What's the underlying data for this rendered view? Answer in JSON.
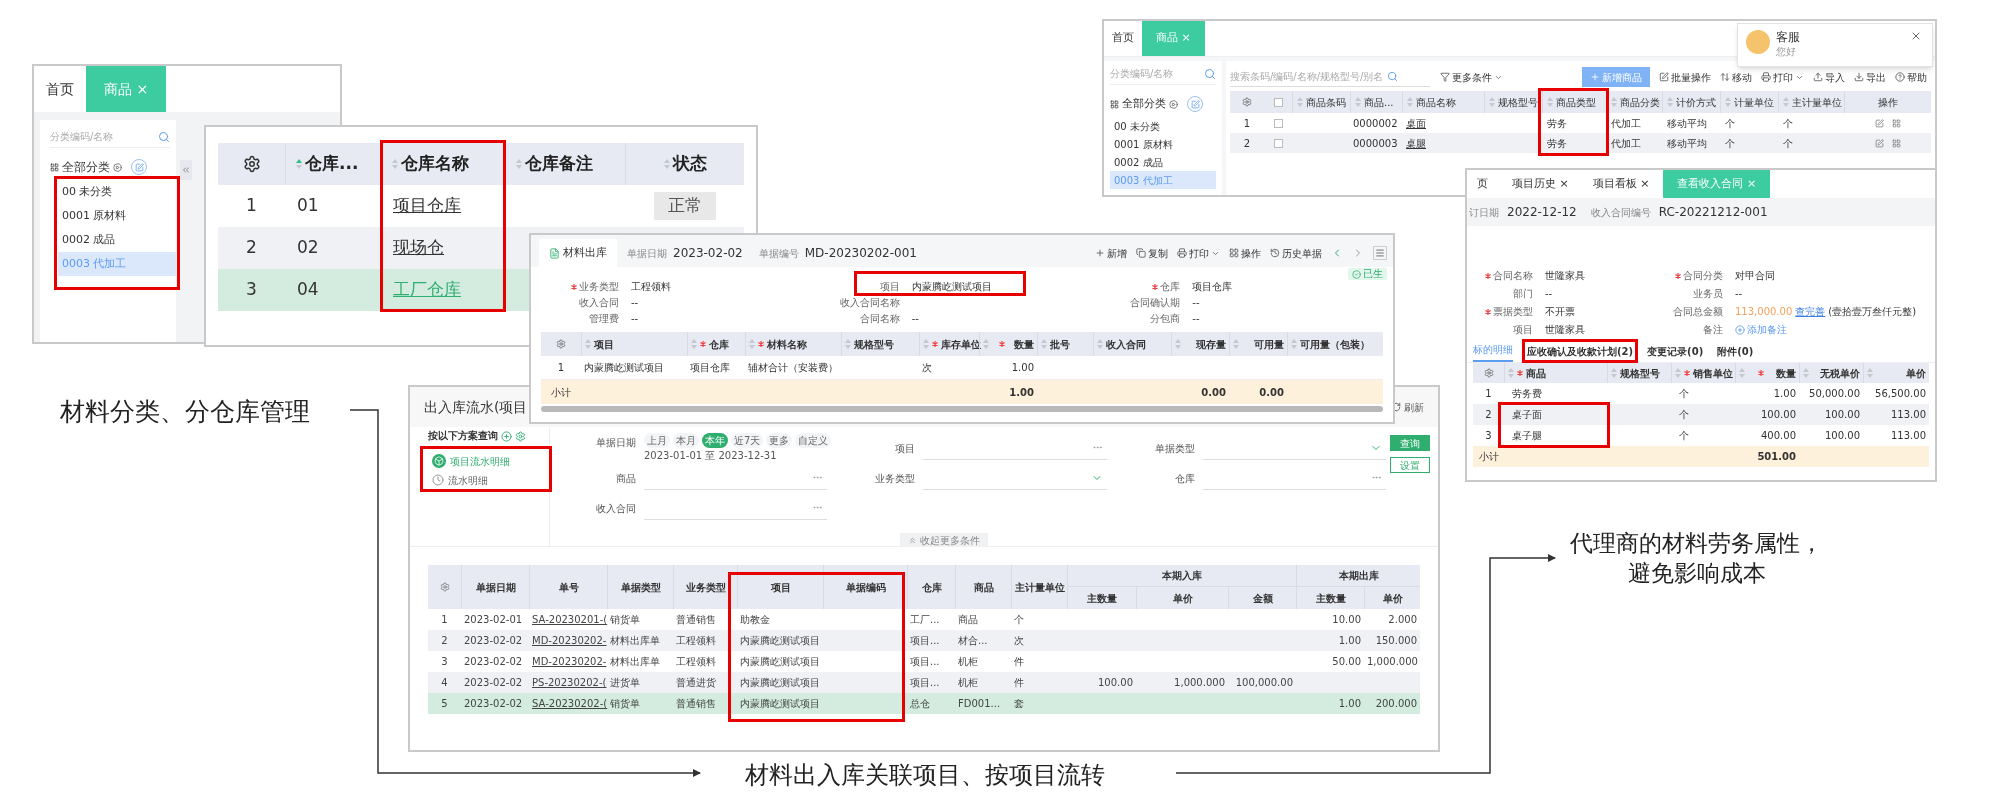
{
  "annotations": {
    "left": "材料分类、分仓库管理",
    "bottom": "材料出入库关联项目、按项目流转",
    "right": [
      "代理商的材料劳务属性，",
      "避免影响成本"
    ]
  },
  "category_panel": {
    "tabs": [
      {
        "label": "首页",
        "selected": false
      },
      {
        "label": "商品 ×",
        "selected": true
      }
    ],
    "search_placeholder": "分类编码/名称",
    "tree_root": "全部分类",
    "categories": [
      {
        "label": "00 未分类",
        "selected": false
      },
      {
        "label": "0001 原材料",
        "selected": false
      },
      {
        "label": "0002 成品",
        "selected": false
      },
      {
        "label": "0003 代加工",
        "selected": true
      }
    ]
  },
  "warehouse_table": {
    "columns": [
      {
        "label": "仓库...",
        "sorted": true
      },
      {
        "label": "仓库名称",
        "sorted": false
      },
      {
        "label": "仓库备注",
        "sorted": false
      },
      {
        "label": "状态",
        "sorted": false
      }
    ],
    "rows": [
      {
        "index": "1",
        "code": "01",
        "name": "项目仓库",
        "status": "正常",
        "selected": false
      },
      {
        "index": "2",
        "code": "02",
        "name": "现场仓",
        "selected": false
      },
      {
        "index": "3",
        "code": "04",
        "name": "工厂仓库",
        "selected": true
      }
    ]
  },
  "material_out": {
    "tab": "材料出库",
    "date_label": "单据日期",
    "date": "2023-02-02",
    "number_label": "单据编号",
    "number": "MD-20230202-001",
    "toolbar": [
      {
        "label": "新增",
        "kind": "add"
      },
      {
        "label": "复制",
        "kind": "copy"
      },
      {
        "label": "打印",
        "kind": "print"
      },
      {
        "label": "操作",
        "kind": "ops"
      },
      {
        "label": "历史单据",
        "kind": "history"
      }
    ],
    "status": "已生",
    "fields": [
      [
        {
          "label": "业务类型",
          "value": "工程领料",
          "required": true
        },
        {
          "label": "收入合同",
          "value": "--",
          "required": false
        },
        {
          "label": "管理费",
          "value": "--",
          "required": false
        }
      ],
      [
        {
          "label": "项目",
          "value": "内蒙腾屹测试项目",
          "required": false
        },
        {
          "label": "收入合同名称",
          "required": false
        },
        {
          "label": "合同名称",
          "value": "--",
          "required": false
        }
      ],
      [
        {
          "label": "仓库",
          "value": "项目仓库",
          "required": true
        },
        {
          "label": "合同确认期",
          "value": "--",
          "required": false
        },
        {
          "label": "分包商",
          "value": "--",
          "required": false
        }
      ]
    ],
    "columns": [
      {
        "label": "项目",
        "required": false
      },
      {
        "label": "仓库",
        "required": true
      },
      {
        "label": "材料名称",
        "required": true
      },
      {
        "label": "规格型号",
        "required": false
      },
      {
        "label": "库存单位",
        "required": true
      },
      {
        "label": "数量",
        "required": true,
        "numeric": true
      },
      {
        "label": "批号",
        "required": false
      },
      {
        "label": "收入合同",
        "required": false
      },
      {
        "label": "现存量",
        "required": false,
        "numeric": true
      },
      {
        "label": "可用量",
        "required": false,
        "numeric": true
      },
      {
        "label": "可用量（包装）",
        "required": false
      }
    ],
    "rows": [
      {
        "index": "1",
        "cells": [
          "内蒙腾屹测试项目",
          "项目仓库",
          "辅材合计（安装费）",
          null,
          "次",
          "1.00",
          null,
          null,
          null,
          null,
          null
        ]
      }
    ],
    "subtotal": {
      "label": "小计",
      "cells": [
        null,
        null,
        null,
        null,
        null,
        "1.00",
        null,
        null,
        "0.00",
        "0.00",
        null
      ]
    }
  },
  "flow": {
    "title": "出入库流水(项目",
    "refresh": "刷新",
    "scheme_header": "按以下方案查询",
    "schemes": [
      {
        "label": "项目流水明细",
        "selected": true
      },
      {
        "label": "流水明细",
        "selected": false
      }
    ],
    "date_label": "单据日期",
    "chips": [
      {
        "label": "上月",
        "selected": false
      },
      {
        "label": "本月",
        "selected": false
      },
      {
        "label": "本年",
        "selected": true
      },
      {
        "label": "近7天",
        "selected": false
      },
      {
        "label": "更多",
        "selected": false
      },
      {
        "label": "自定义",
        "selected": false
      }
    ],
    "date_range": "2023-01-01 至 2023-12-31",
    "filters": [
      {
        "label": "项目",
        "kind": "lookup"
      },
      {
        "label": "单据类型",
        "kind": "select"
      },
      {
        "label": "商品",
        "kind": "lookup"
      },
      {
        "label": "业务类型",
        "kind": "select"
      },
      {
        "label": "仓库",
        "kind": "lookup"
      },
      {
        "label": "收入合同",
        "kind": "lookup"
      }
    ],
    "query": "查询",
    "settings": "设置",
    "collapse": "收起更多条件",
    "columns": [
      {
        "label": "单据日期"
      },
      {
        "label": "单号",
        "link": true
      },
      {
        "label": "单据类型"
      },
      {
        "label": "业务类型"
      },
      {
        "label": "项目"
      },
      {
        "label": "单据编码"
      },
      {
        "label": "仓库"
      },
      {
        "label": "商品"
      },
      {
        "label": "主计量单位"
      }
    ],
    "groups": [
      {
        "label": "本期入库",
        "columns": [
          {
            "label": "主数量",
            "numeric": true
          },
          {
            "label": "单价",
            "numeric": true
          },
          {
            "label": "金额",
            "numeric": true
          }
        ]
      },
      {
        "label": "本期出库",
        "columns": [
          {
            "label": "主数量",
            "numeric": true
          },
          {
            "label": "单价",
            "numeric": true
          }
        ]
      }
    ],
    "rows": [
      {
        "index": "1",
        "selected": false,
        "cells": [
          "2023-02-01",
          "SA-20230201-(",
          "销货单",
          "普通销售",
          "助教金",
          null,
          "工厂...",
          "商品",
          "个",
          null,
          null,
          null,
          "10.00",
          "2.000"
        ]
      },
      {
        "index": "2",
        "selected": false,
        "cells": [
          "2023-02-02",
          "MD-20230202-",
          "材料出库单",
          "工程领料",
          "内蒙腾屹测试项目",
          null,
          "项目...",
          "材合...",
          "次",
          null,
          null,
          null,
          "1.00",
          "150.000"
        ]
      },
      {
        "index": "3",
        "selected": false,
        "cells": [
          "2023-02-02",
          "MD-20230202-",
          "材料出库单",
          "工程领料",
          "内蒙腾屹测试项目",
          null,
          "项目...",
          "机柜",
          "件",
          null,
          null,
          null,
          "50.00",
          "1,000.000"
        ]
      },
      {
        "index": "4",
        "selected": false,
        "cells": [
          "2023-02-02",
          "PS-20230202-(",
          "进货单",
          "普通进货",
          "内蒙腾屹测试项目",
          null,
          "项目...",
          "机柜",
          "件",
          "100.00",
          "1,000.000",
          "100,000.00",
          null,
          null
        ]
      },
      {
        "index": "5",
        "selected": true,
        "cells": [
          "2023-02-02",
          "SA-20230202-(",
          "销货单",
          "普通销售",
          "内蒙腾屹测试项目",
          null,
          "总仓",
          "FD001...",
          "套",
          null,
          null,
          null,
          "1.00",
          "200.000"
        ]
      }
    ]
  },
  "goods": {
    "tabs": [
      {
        "label": "首页",
        "selected": false
      },
      {
        "label": "商品 ×",
        "selected": true
      }
    ],
    "search_placeholder": "分类编码/名称",
    "tree_root": "全部分类",
    "categories": [
      {
        "label": "00 未分类",
        "selected": false
      },
      {
        "label": "0001 原材料",
        "selected": false
      },
      {
        "label": "0002 成品",
        "selected": false
      },
      {
        "label": "0003 代加工",
        "selected": true
      }
    ],
    "all_checked": false,
    "list_search_placeholder": "搜索条码/编码/名称/规格型号/别名",
    "more_filters": "更多条件",
    "add": "新增商品",
    "toolbar": [
      {
        "label": "批量操作",
        "kind": "batch"
      },
      {
        "label": "移动",
        "kind": "move"
      },
      {
        "label": "打印",
        "kind": "print"
      },
      {
        "label": "导入",
        "kind": "import"
      },
      {
        "label": "导出",
        "kind": "export"
      },
      {
        "label": "帮助",
        "kind": "help"
      }
    ],
    "columns": [
      {
        "label": "商品条码"
      },
      {
        "label": "商品..."
      },
      {
        "label": "商品名称",
        "link": true
      },
      {
        "label": "规格型号"
      },
      {
        "label": "商品类型"
      },
      {
        "label": "商品分类"
      },
      {
        "label": "计价方式"
      },
      {
        "label": "计量单位"
      },
      {
        "label": "主计量单位"
      }
    ],
    "action_column": "操作",
    "rows": [
      {
        "index": "1",
        "checked": false,
        "cells": [
          null,
          "0000002",
          "桌面",
          null,
          "劳务",
          "代加工",
          "移动平均",
          "个",
          "个"
        ]
      },
      {
        "index": "2",
        "checked": false,
        "cells": [
          null,
          "0000003",
          "桌腿",
          null,
          "劳务",
          "代加工",
          "移动平均",
          "个",
          "个"
        ]
      }
    ],
    "chat": {
      "title": "客服",
      "greeting": "您好"
    }
  },
  "contract": {
    "tabs": [
      {
        "label": "页",
        "selected": false
      },
      {
        "label": "项目历史 ×",
        "selected": false
      },
      {
        "label": "项目看板 ×",
        "selected": false
      },
      {
        "label": "查看收入合同 ×",
        "selected": true
      }
    ],
    "date_label": "订日期",
    "date": "2022-12-12",
    "number_label": "收入合同编号",
    "number": "RC-20221212-001",
    "fields": [
      {
        "label": "合同名称",
        "value": "世隆家具",
        "required": true,
        "kind": "text"
      },
      {
        "label": "合同分类",
        "value": "对甲合同",
        "required": true,
        "kind": "text"
      },
      {
        "label": "部门",
        "value": "--",
        "required": false,
        "kind": "text"
      },
      {
        "label": "业务员",
        "value": "--",
        "required": false,
        "kind": "text"
      },
      {
        "label": "票据类型",
        "value": "不开票",
        "required": true,
        "kind": "text"
      },
      {
        "label": "合同总金额",
        "value": "113,000.00",
        "link": "查完善",
        "note": "(壹拾壹万叁仟元整)",
        "required": false,
        "kind": "amount"
      },
      {
        "label": "项目",
        "value": "世隆家具",
        "required": false,
        "kind": "text"
      },
      {
        "label": "备注",
        "link": "添加备注",
        "required": false,
        "kind": "add_note"
      }
    ],
    "detail_tabs": [
      {
        "label": "标的明细",
        "selected": true
      },
      {
        "label": "应收确认及收款计划(2)",
        "selected": false
      },
      {
        "label": "变更记录(0)",
        "selected": false
      },
      {
        "label": "附件(0)",
        "selected": false
      }
    ],
    "columns": [
      {
        "label": "商品",
        "required": true
      },
      {
        "label": "规格型号",
        "required": false
      },
      {
        "label": "销售单位",
        "required": true
      },
      {
        "label": "数量",
        "required": true,
        "numeric": true
      },
      {
        "label": "无税单价",
        "required": false,
        "numeric": true
      },
      {
        "label": "单价",
        "required": false,
        "numeric": true
      }
    ],
    "rows": [
      {
        "index": "1",
        "cells": [
          "劳务费",
          null,
          "个",
          "1.00",
          "50,000.00",
          "56,500.00"
        ]
      },
      {
        "index": "2",
        "cells": [
          "桌子面",
          null,
          "个",
          "100.00",
          "100.00",
          "113.00"
        ]
      },
      {
        "index": "3",
        "cells": [
          "桌子腿",
          null,
          "个",
          "400.00",
          "100.00",
          "113.00"
        ]
      }
    ],
    "subtotal": {
      "label": "小计",
      "cells": [
        null,
        null,
        null,
        "501.00",
        null,
        null
      ]
    }
  }
}
